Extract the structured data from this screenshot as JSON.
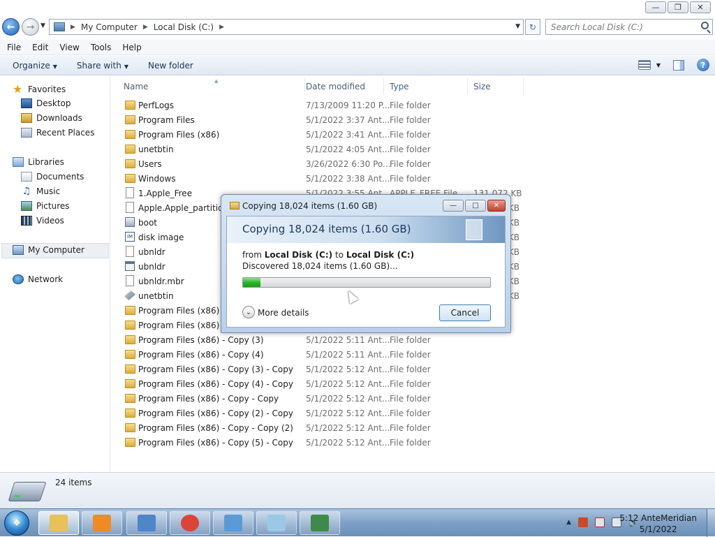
{
  "address": {
    "segments": [
      "My Computer",
      "Local Disk (C:)"
    ],
    "search_placeholder": "Search Local Disk (C:)"
  },
  "menu": [
    "File",
    "Edit",
    "View",
    "Tools",
    "Help"
  ],
  "commands": {
    "organize": "Organize",
    "share": "Share with",
    "new_folder": "New folder"
  },
  "nav": {
    "favorites": "Favorites",
    "favorites_items": [
      "Desktop",
      "Downloads",
      "Recent Places"
    ],
    "libraries": "Libraries",
    "libraries_items": [
      "Documents",
      "Music",
      "Pictures",
      "Videos"
    ],
    "computer": "My Computer",
    "network": "Network"
  },
  "columns": {
    "name": "Name",
    "date": "Date modified",
    "type": "Type",
    "size": "Size"
  },
  "files": [
    {
      "name": "PerfLogs",
      "date": "7/13/2009 11:20 P...",
      "type": "File folder",
      "size": "",
      "icon": "folder-icon"
    },
    {
      "name": "Program Files",
      "date": "5/1/2022 3:37 Ant...",
      "type": "File folder",
      "size": "",
      "icon": "folder-icon"
    },
    {
      "name": "Program Files (x86)",
      "date": "5/1/2022 3:41 Ant...",
      "type": "File folder",
      "size": "",
      "icon": "folder-icon"
    },
    {
      "name": "unetbtin",
      "date": "5/1/2022 4:05 Ant...",
      "type": "File folder",
      "size": "",
      "icon": "folder-icon"
    },
    {
      "name": "Users",
      "date": "3/26/2022 6:30 Po...",
      "type": "File folder",
      "size": "",
      "icon": "folder-icon"
    },
    {
      "name": "Windows",
      "date": "5/1/2022 3:38 Ant...",
      "type": "File folder",
      "size": "",
      "icon": "folder-icon"
    },
    {
      "name": "1.Apple_Free",
      "date": "5/1/2022 3:55 Ant...",
      "type": "APPLE_FREE File",
      "size": "131,072 KB",
      "icon": "file-icon"
    },
    {
      "name": "Apple.Apple_partition_",
      "date": "",
      "type": "",
      "size": "KB",
      "icon": "file-icon"
    },
    {
      "name": "boot",
      "date": "",
      "type": "",
      "size": "KB",
      "icon": "system-file-icon"
    },
    {
      "name": "disk image",
      "date": "",
      "type": "",
      "size": "KB",
      "icon": "image-file-icon"
    },
    {
      "name": "ubnldr",
      "date": "",
      "type": "",
      "size": "KB",
      "icon": "file-icon"
    },
    {
      "name": "ubnldr",
      "date": "",
      "type": "",
      "size": "KB",
      "icon": "executable-icon"
    },
    {
      "name": "ubnldr.mbr",
      "date": "",
      "type": "",
      "size": "KB",
      "icon": "file-icon"
    },
    {
      "name": "unetbtin",
      "date": "",
      "type": "",
      "size": "KB",
      "icon": "application-icon"
    },
    {
      "name": "Program Files (x86) - C",
      "date": "",
      "type": "",
      "size": "",
      "icon": "folder-icon"
    },
    {
      "name": "Program Files (x86) - C",
      "date": "",
      "type": "",
      "size": "",
      "icon": "folder-icon"
    },
    {
      "name": "Program Files (x86) - Copy (3)",
      "date": "5/1/2022 5:11 Ant...",
      "type": "File folder",
      "size": "",
      "icon": "folder-icon"
    },
    {
      "name": "Program Files (x86) - Copy (4)",
      "date": "5/1/2022 5:11 Ant...",
      "type": "File folder",
      "size": "",
      "icon": "folder-icon"
    },
    {
      "name": "Program Files (x86) - Copy (3) - Copy",
      "date": "5/1/2022 5:12 Ant...",
      "type": "File folder",
      "size": "",
      "icon": "folder-icon"
    },
    {
      "name": "Program Files (x86) - Copy (4) - Copy",
      "date": "5/1/2022 5:12 Ant...",
      "type": "File folder",
      "size": "",
      "icon": "folder-icon"
    },
    {
      "name": "Program Files (x86) - Copy - Copy",
      "date": "5/1/2022 5:12 Ant...",
      "type": "File folder",
      "size": "",
      "icon": "folder-icon"
    },
    {
      "name": "Program Files (x86) - Copy (2) - Copy",
      "date": "5/1/2022 5:12 Ant...",
      "type": "File folder",
      "size": "",
      "icon": "folder-icon"
    },
    {
      "name": "Program Files (x86) - Copy - Copy (2)",
      "date": "5/1/2022 5:12 Ant...",
      "type": "File folder",
      "size": "",
      "icon": "folder-icon"
    },
    {
      "name": "Program Files (x86) - Copy (5) - Copy",
      "date": "5/1/2022 5:12 Ant...",
      "type": "File folder",
      "size": "",
      "icon": "folder-icon"
    }
  ],
  "status": {
    "count": "24 items"
  },
  "dialog": {
    "title": "Copying 18,024 items (1.60 GB)",
    "heading": "Copying 18,024 items (1.60 GB)",
    "from_word": "from",
    "source": "Local Disk (C:)",
    "to_word": "to",
    "dest": "Local Disk (C:)",
    "discovered": "Discovered 18,024 items (1.60 GB)...",
    "progress_percent": 7,
    "more_details": "More details",
    "cancel": "Cancel"
  },
  "taskbar": {
    "apps": [
      {
        "name": "windows-explorer",
        "color": "#e8c158"
      },
      {
        "name": "media-player",
        "color": "#f08a24"
      },
      {
        "name": "control-panel",
        "color": "#4f86c6"
      },
      {
        "name": "chrome",
        "color": "#db4437"
      },
      {
        "name": "photo-viewer",
        "color": "#5b9ad6"
      },
      {
        "name": "notepad",
        "color": "#9cc8e8"
      },
      {
        "name": "task-manager",
        "color": "#3f8a4a"
      }
    ],
    "clock_time": "5:12 AnteMeridian",
    "clock_date": "5/1/2022"
  }
}
